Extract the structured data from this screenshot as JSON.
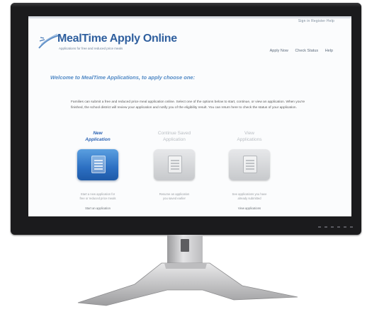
{
  "header": {
    "top_links": "Sign in Register Help",
    "logo_title": "MealTime Apply Online",
    "logo_subtitle": "Applications for free and reduced price meals",
    "nav": [
      "Apply Now",
      "Check Status",
      "Help"
    ]
  },
  "main": {
    "welcome": "Welcome to MealTime Applications, to apply choose one:",
    "intro": "Families can submit a free and reduced price meal application online. Select one of the options below to start, continue, or view an application. When you're finished, the school district will review your application and notify you of the eligibility result. You can return here to check the status of your application.",
    "options": [
      {
        "title": "New\nApplication",
        "description": "Start a new application for\nfree or reduced price meals",
        "link": "Start an application",
        "state": "active"
      },
      {
        "title": "Continue Saved\nApplication",
        "description": "Resume an application\nyou saved earlier",
        "link": "",
        "state": "inactive"
      },
      {
        "title": "View\nApplications",
        "description": "See applications you have\nalready submitted",
        "link": "View applications",
        "state": "inactive"
      }
    ]
  },
  "colors": {
    "brand": "#2f5f9e",
    "accent": "#4f88c5",
    "tile_active": "#2c6fc2",
    "tile_inactive": "#c7c9cc"
  },
  "icons": {
    "logo": "swoosh-logo-icon",
    "tile": "document-icon"
  }
}
